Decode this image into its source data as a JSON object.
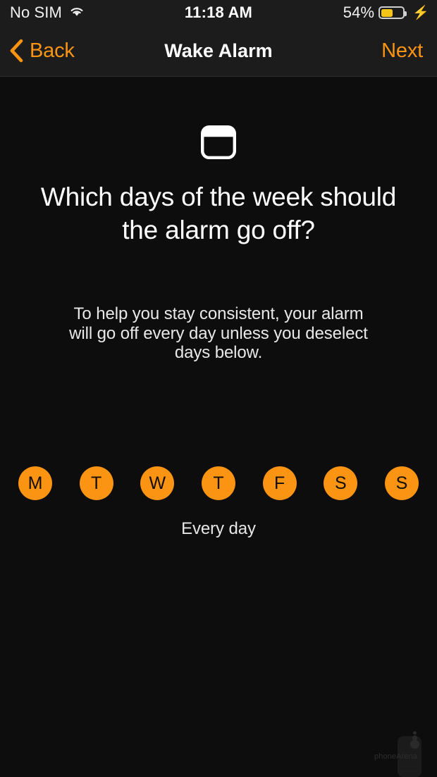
{
  "status_bar": {
    "carrier": "No SIM",
    "wifi_icon": "wifi-icon",
    "time": "11:18 AM",
    "battery_percent": "54%",
    "battery_level": 54,
    "battery_color": "#f5c518",
    "charging_icon": "lightning-bolt-icon"
  },
  "nav_bar": {
    "back_label": "Back",
    "back_icon": "chevron-left-icon",
    "title": "Wake Alarm",
    "next_label": "Next",
    "accent_color": "#fa9412"
  },
  "main": {
    "hero_icon": "calendar-icon",
    "headline": "Which days of the week should the alarm go off?",
    "subtext": "To help you stay consistent, your alarm will go off every day unless you deselect days below.",
    "days": [
      {
        "label": "M",
        "name": "monday",
        "selected": true
      },
      {
        "label": "T",
        "name": "tuesday",
        "selected": true
      },
      {
        "label": "W",
        "name": "wednesday",
        "selected": true
      },
      {
        "label": "T",
        "name": "thursday",
        "selected": true
      },
      {
        "label": "F",
        "name": "friday",
        "selected": true
      },
      {
        "label": "S",
        "name": "saturday",
        "selected": true
      },
      {
        "label": "S",
        "name": "sunday",
        "selected": true
      }
    ],
    "summary": "Every day"
  },
  "watermark": {
    "text": "phoneArena",
    "sub": "phoneArena"
  }
}
